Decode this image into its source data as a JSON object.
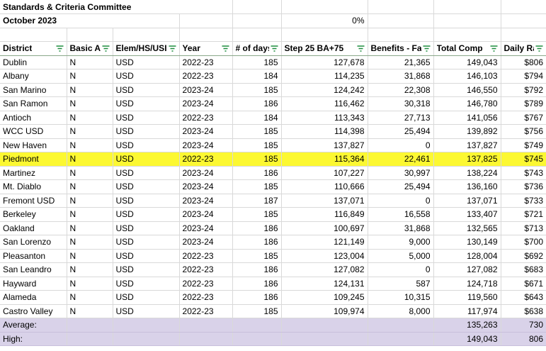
{
  "sheet": {
    "title": "Standards & Criteria Committee",
    "subtitle": "October 2023",
    "percent": "0%",
    "highlight_color": "#fcf832",
    "summary_color": "#d9d2e9",
    "filter_icon": "filter-icon"
  },
  "headers": [
    "District",
    "Basic A",
    "Elem/HS/USI",
    "Year",
    "# of days",
    "Step 25 BA+75",
    "Benefits - Fa",
    "Total Comp",
    "Daily Ra"
  ],
  "rows": [
    [
      "Dublin",
      "N",
      "USD",
      "2022-23",
      "185",
      "127,678",
      "21,365",
      "149,043",
      "$806"
    ],
    [
      "Albany",
      "N",
      "USD",
      "2022-23",
      "184",
      "114,235",
      "31,868",
      "146,103",
      "$794"
    ],
    [
      "San Marino",
      "N",
      "USD",
      "2023-24",
      "185",
      "124,242",
      "22,308",
      "146,550",
      "$792"
    ],
    [
      "San Ramon",
      "N",
      "USD",
      "2023-24",
      "186",
      "116,462",
      "30,318",
      "146,780",
      "$789"
    ],
    [
      "Antioch",
      "N",
      "USD",
      "2022-23",
      "184",
      "113,343",
      "27,713",
      "141,056",
      "$767"
    ],
    [
      "WCC USD",
      "N",
      "USD",
      "2023-24",
      "185",
      "114,398",
      "25,494",
      "139,892",
      "$756"
    ],
    [
      "New Haven",
      "N",
      "USD",
      "2023-24",
      "185",
      "137,827",
      "0",
      "137,827",
      "$749"
    ],
    [
      "Piedmont",
      "N",
      "USD",
      "2022-23",
      "185",
      "115,364",
      "22,461",
      "137,825",
      "$745"
    ],
    [
      "Martinez",
      "N",
      "USD",
      "2023-24",
      "186",
      "107,227",
      "30,997",
      "138,224",
      "$743"
    ],
    [
      "Mt. Diablo",
      "N",
      "USD",
      "2023-24",
      "185",
      "110,666",
      "25,494",
      "136,160",
      "$736"
    ],
    [
      "Fremont USD",
      "N",
      "USD",
      "2023-24",
      "187",
      "137,071",
      "0",
      "137,071",
      "$733"
    ],
    [
      "Berkeley",
      "N",
      "USD",
      "2023-24",
      "185",
      "116,849",
      "16,558",
      "133,407",
      "$721"
    ],
    [
      "Oakland",
      "N",
      "USD",
      "2023-24",
      "186",
      "100,697",
      "31,868",
      "132,565",
      "$713"
    ],
    [
      "San Lorenzo",
      "N",
      "USD",
      "2023-24",
      "186",
      "121,149",
      "9,000",
      "130,149",
      "$700"
    ],
    [
      "Pleasanton",
      "N",
      "USD",
      "2022-23",
      "185",
      "123,004",
      "5,000",
      "128,004",
      "$692"
    ],
    [
      "San Leandro",
      "N",
      "USD",
      "2022-23",
      "186",
      "127,082",
      "0",
      "127,082",
      "$683"
    ],
    [
      "Hayward",
      "N",
      "USD",
      "2022-23",
      "186",
      "124,131",
      "587",
      "124,718",
      "$671"
    ],
    [
      "Alameda",
      "N",
      "USD",
      "2022-23",
      "186",
      "109,245",
      "10,315",
      "119,560",
      "$643"
    ],
    [
      "Castro Valley",
      "N",
      "USD",
      "2022-23",
      "185",
      "109,974",
      "8,000",
      "117,974",
      "$638"
    ]
  ],
  "highlighted_row": "Piedmont",
  "summary": [
    {
      "label": "Average:",
      "total": "135,263",
      "daily": "730"
    },
    {
      "label": "High:",
      "total": "149,043",
      "daily": "806"
    }
  ]
}
